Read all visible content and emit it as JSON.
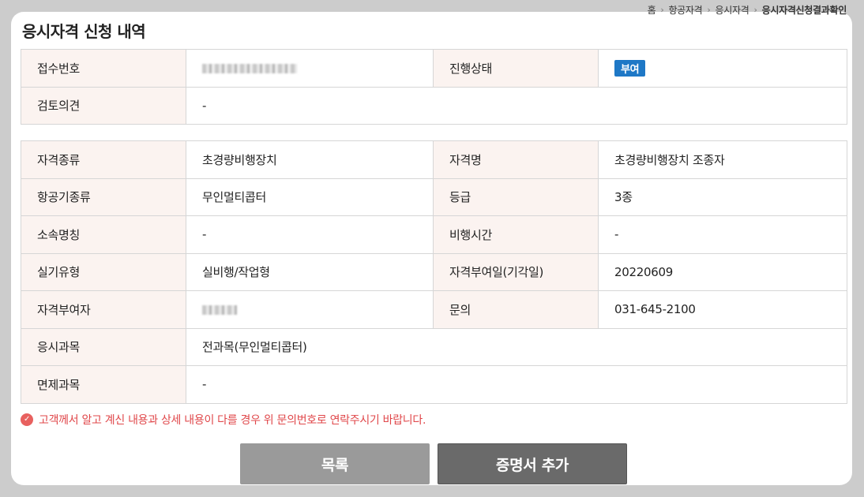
{
  "breadcrumb": {
    "home": "홈",
    "level1": "항공자격",
    "level2": "응시자격",
    "current": "응시자격신청결과확인"
  },
  "page_title": "응시자격 신청 내역",
  "summary": {
    "receipt_no_label": "접수번호",
    "status_label": "진행상태",
    "status_value": "부여",
    "review_label": "검토의견",
    "review_value": "-"
  },
  "details": {
    "qual_type_label": "자격종류",
    "qual_type_value": "초경량비행장치",
    "qual_name_label": "자격명",
    "qual_name_value": "초경량비행장치 조종자",
    "aircraft_type_label": "항공기종류",
    "aircraft_type_value": "무인멀티콥터",
    "grade_label": "등급",
    "grade_value": "3종",
    "affiliation_label": "소속명칭",
    "affiliation_value": "-",
    "flight_time_label": "비행시간",
    "flight_time_value": "-",
    "practical_type_label": "실기유형",
    "practical_type_value": "실비행/작업형",
    "granted_date_label": "자격부여일(기각일)",
    "granted_date_value": "20220609",
    "granter_label": "자격부여자",
    "inquiry_label": "문의",
    "inquiry_value": "031-645-2100",
    "exam_subject_label": "응시과목",
    "exam_subject_value": "전과목(무인멀티콥터)",
    "exempt_subject_label": "면제과목",
    "exempt_subject_value": "-"
  },
  "notice": "고객께서 알고 계신 내용과 상세 내용이 다를 경우 위 문의번호로 연락주시기 바랍니다.",
  "buttons": {
    "list_label": "목록",
    "add_certificate_label": "증명서 추가"
  },
  "colors": {
    "badge": "#1e78c6",
    "header_cell_bg": "#fbf3f0",
    "notice_text": "#e0474a",
    "list_button": "#9a9a9a",
    "add_button": "#6a6a6a"
  }
}
